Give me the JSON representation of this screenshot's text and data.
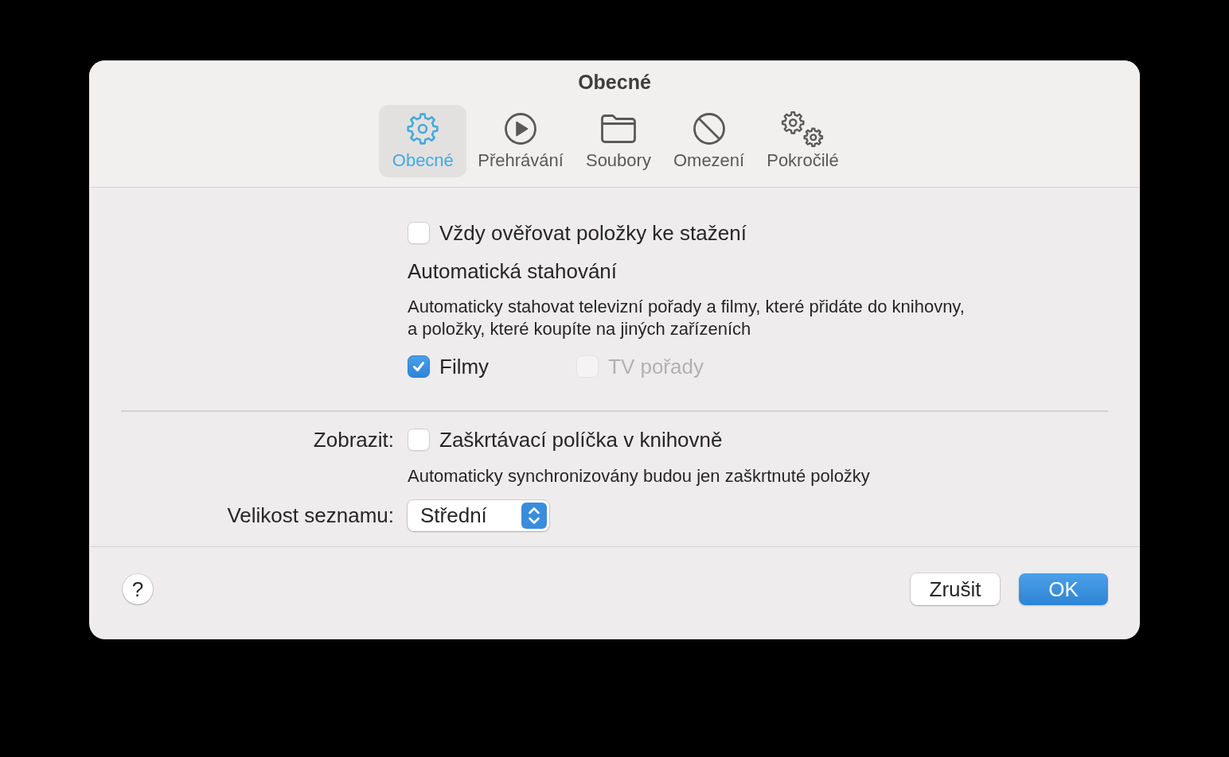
{
  "window": {
    "title": "Obecné"
  },
  "tabs": [
    {
      "label": "Obecné",
      "selected": true
    },
    {
      "label": "Přehrávání",
      "selected": false
    },
    {
      "label": "Soubory",
      "selected": false
    },
    {
      "label": "Omezení",
      "selected": false
    },
    {
      "label": "Pokročilé",
      "selected": false
    }
  ],
  "general": {
    "always_verify": {
      "label": "Vždy ověřovat položky ke stažení",
      "checked": false
    },
    "automatic_downloads": {
      "heading": "Automatická stahování",
      "description": "Automaticky stahovat televizní pořady a filmy, které přidáte do knihovny, a položky, které koupíte na jiných zařízeních",
      "options": [
        {
          "label": "Filmy",
          "checked": true,
          "disabled": false
        },
        {
          "label": "TV pořady",
          "checked": false,
          "disabled": true
        }
      ]
    },
    "show": {
      "label": "Zobrazit:",
      "checkbox": {
        "label": "Zaškrtávací políčka v knihovně",
        "checked": false
      },
      "note": "Automaticky synchronizovány budou jen zaškrtnuté položky"
    },
    "list_size": {
      "label": "Velikost seznamu:",
      "value": "Střední"
    }
  },
  "footer": {
    "help": "?",
    "buttons": [
      {
        "label": "Zrušit",
        "kind": "cancel"
      },
      {
        "label": "OK",
        "kind": "confirm"
      }
    ]
  }
}
